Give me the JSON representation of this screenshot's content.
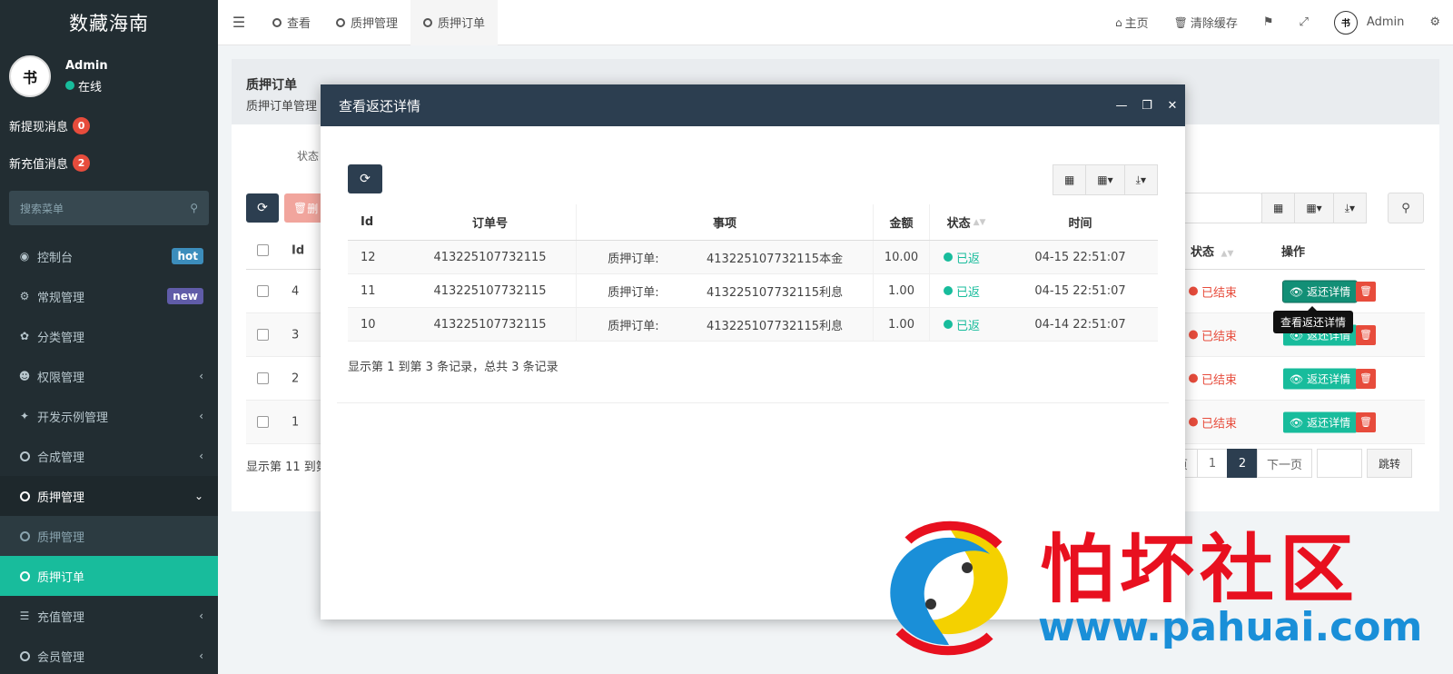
{
  "app": {
    "brand": "数藏海南"
  },
  "user": {
    "name": "Admin",
    "status": "在线"
  },
  "notices": [
    {
      "label": "新提现消息",
      "count": "0"
    },
    {
      "label": "新充值消息",
      "count": "2"
    }
  ],
  "sidebar": {
    "search_placeholder": "搜索菜单",
    "items": [
      {
        "label": "控制台",
        "icon": "dashboard-icon",
        "badge": "hot"
      },
      {
        "label": "常规管理",
        "icon": "cogs-icon",
        "badge": "new"
      },
      {
        "label": "分类管理",
        "icon": "leaf-icon"
      },
      {
        "label": "权限管理",
        "icon": "group-icon"
      },
      {
        "label": "开发示例管理",
        "icon": "magic-icon"
      },
      {
        "label": "合成管理",
        "icon": "circle-icon"
      },
      {
        "label": "质押管理",
        "icon": "circle-icon"
      },
      {
        "label": "质押管理",
        "icon": "circle-icon"
      },
      {
        "label": "质押订单",
        "icon": "circle-icon"
      },
      {
        "label": "充值管理",
        "icon": "list-icon"
      },
      {
        "label": "会员管理",
        "icon": "circle-icon"
      }
    ]
  },
  "navbar": {
    "tabs": [
      "查看",
      "质押管理",
      "质押订单"
    ],
    "home": "主页",
    "clear_cache": "清除缓存",
    "admin": "Admin"
  },
  "page": {
    "title": "质押订单",
    "subtitle": "质押订单管理",
    "filter_label": "状态",
    "delete_label": "删",
    "table_headers": {
      "id": "Id",
      "state": "状态",
      "op": "操作"
    },
    "rows": [
      {
        "id": "4",
        "state": "已结束"
      },
      {
        "id": "3",
        "state": "已结束"
      },
      {
        "id": "2",
        "state": "已结束"
      },
      {
        "id": "1",
        "state": "已结束"
      }
    ],
    "detail_button": "返还详情",
    "tooltip": "查看返还详情",
    "footer": "显示第 11 到第",
    "pagination": {
      "prev": "页",
      "pages": [
        "1",
        "2"
      ],
      "next": "下一页",
      "go": "跳转"
    }
  },
  "modal": {
    "title": "查看返还详情",
    "headers": {
      "id": "Id",
      "order_no": "订单号",
      "item": "事项",
      "amount": "金额",
      "state": "状态",
      "time": "时间"
    },
    "rows": [
      {
        "id": "12",
        "order_no": "413225107732115",
        "item_label": "质押订单:",
        "item_value": "413225107732115本金",
        "amount": "10.00",
        "state": "已返",
        "time": "04-15 22:51:07"
      },
      {
        "id": "11",
        "order_no": "413225107732115",
        "item_label": "质押订单:",
        "item_value": "413225107732115利息",
        "amount": "1.00",
        "state": "已返",
        "time": "04-15 22:51:07"
      },
      {
        "id": "10",
        "order_no": "413225107732115",
        "item_label": "质押订单:",
        "item_value": "413225107732115利息",
        "amount": "1.00",
        "state": "已返",
        "time": "04-14 22:51:07"
      }
    ],
    "footer": "显示第 1 到第 3 条记录，总共 3 条记录"
  },
  "watermark": {
    "title": "怕坏社区",
    "url": "www.pahuai.com"
  },
  "colors": {
    "sidebar": "#222d32",
    "accent": "#18bc9c",
    "danger": "#e74c3c",
    "primary_dark": "#2c3e50"
  }
}
